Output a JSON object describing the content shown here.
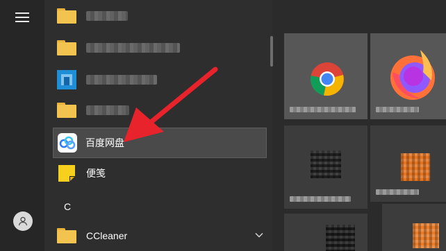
{
  "start_menu": {
    "rail": {
      "menu_icon": "hamburger-menu-icon",
      "user_icon": "user-avatar-icon"
    },
    "app_list": {
      "items": [
        {
          "label": "",
          "icon": "folder-icon",
          "blurred": true
        },
        {
          "label": "",
          "icon": "folder-icon",
          "blurred": true
        },
        {
          "label": "",
          "icon": "app-icon",
          "blurred": true
        },
        {
          "label": "",
          "icon": "folder-icon",
          "blurred": true
        },
        {
          "label": "百度网盘",
          "icon": "baidu-netdisk-icon",
          "highlighted": true
        },
        {
          "label": "便笺",
          "icon": "sticky-notes-icon"
        }
      ],
      "section_letter": "C",
      "ccleaner": {
        "label": "CCleaner",
        "icon": "folder-icon",
        "expand_icon": "chevron-down-icon"
      }
    },
    "tiles": [
      {
        "name": "chrome-tile",
        "icon": "chrome-icon"
      },
      {
        "name": "firefox-tile",
        "icon": "firefox-icon"
      },
      {
        "name": "app-tile-3",
        "icon": "app-icon"
      },
      {
        "name": "app-tile-4",
        "icon": "app-icon"
      },
      {
        "name": "app-tile-5",
        "icon": "app-icon"
      },
      {
        "name": "app-tile-6",
        "icon": "app-icon"
      }
    ],
    "annotation": {
      "type": "red-arrow",
      "color": "#e8232b",
      "points_to": "百度网盘"
    },
    "colors": {
      "folder": "#f2c34f",
      "highlight": "#4a4a4a",
      "arrow": "#e8232b"
    }
  }
}
